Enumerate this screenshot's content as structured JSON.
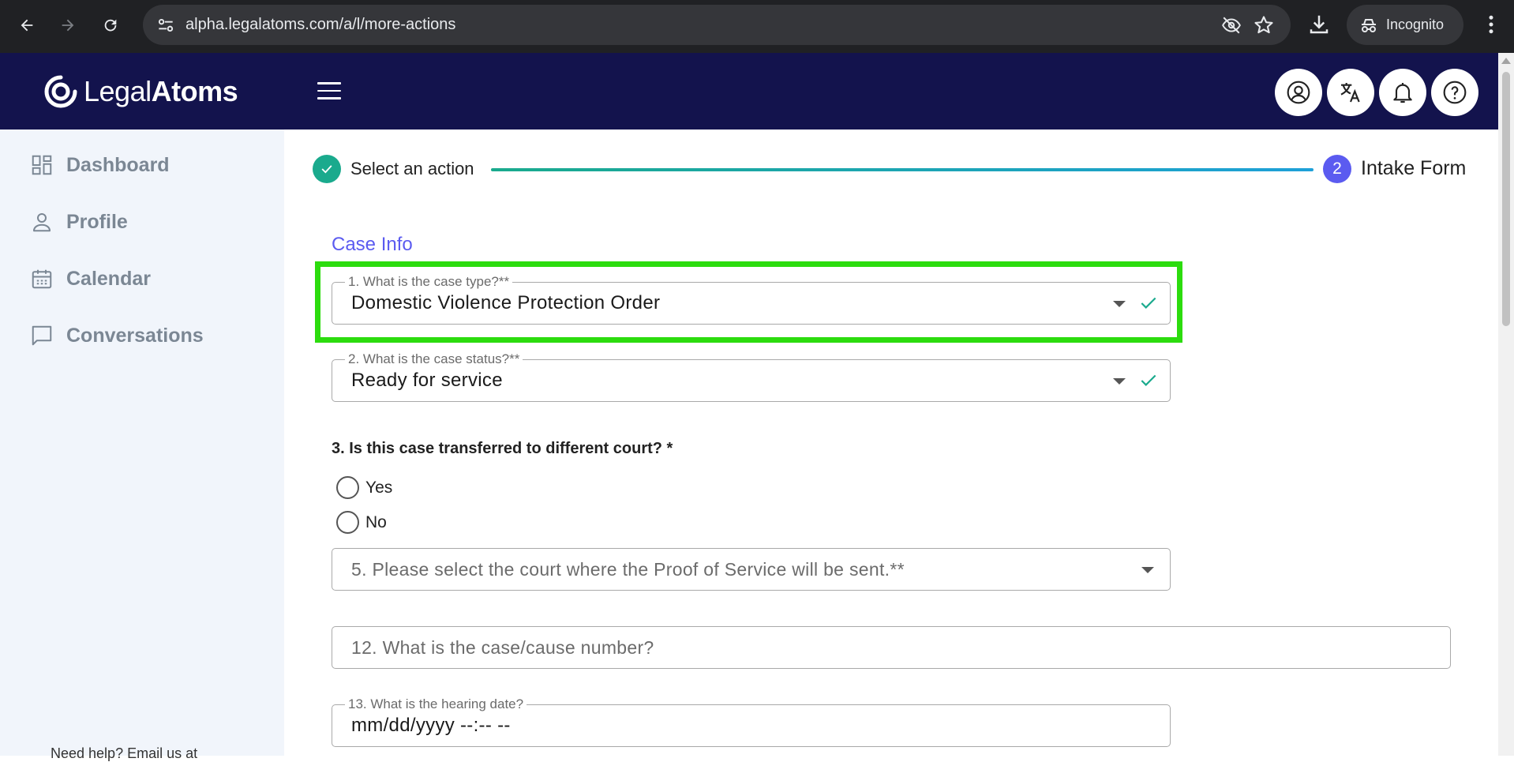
{
  "browser": {
    "url": "alpha.legalatoms.com/a/l/more-actions",
    "incognito_label": "Incognito"
  },
  "header": {
    "logo_text_light": "Legal",
    "logo_text_bold": "Atoms"
  },
  "sidebar": {
    "items": [
      {
        "label": "Dashboard",
        "icon": "dashboard-icon"
      },
      {
        "label": "Profile",
        "icon": "person-icon"
      },
      {
        "label": "Calendar",
        "icon": "calendar-icon"
      },
      {
        "label": "Conversations",
        "icon": "chat-icon"
      }
    ],
    "footer": "Need help? Email us at"
  },
  "stepper": {
    "step1_label": "Select an action",
    "step2_number": "2",
    "step2_label": "Intake Form"
  },
  "form": {
    "section_title": "Case Info",
    "case_type": {
      "label": "1. What is the case type?**",
      "value": "Domestic Violence Protection Order"
    },
    "case_status": {
      "label": "2. What is the case status?**",
      "value": "Ready for service"
    },
    "transferred": {
      "question": "3. Is this case transferred to different court? *",
      "options": [
        "Yes",
        "No"
      ]
    },
    "court": {
      "placeholder": "5. Please select the court where the Proof of Service will be sent.**"
    },
    "case_number": {
      "placeholder": "12. What is the case/cause number?"
    },
    "hearing_date": {
      "label": "13. What is the hearing date?",
      "value": "mm/dd/yyyy --:-- --"
    }
  },
  "colors": {
    "header_bg": "#13134d",
    "accent": "#5b5bf0",
    "success": "#1aaa8d",
    "highlight": "#2cdc0e"
  }
}
